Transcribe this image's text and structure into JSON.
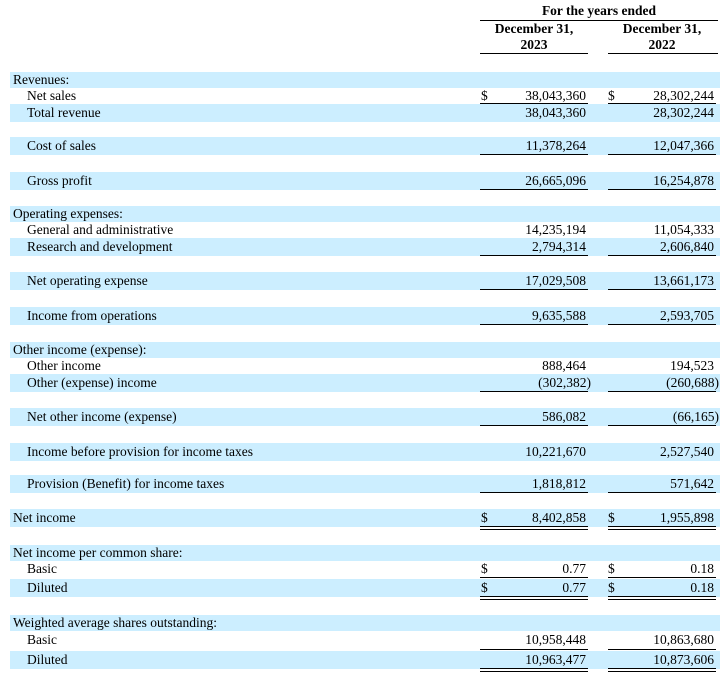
{
  "header": {
    "period": "For the years ended",
    "col1_line1": "December 31,",
    "col1_line2": "2023",
    "col2_line1": "December 31,",
    "col2_line2": "2022"
  },
  "currency_symbol": "$",
  "colors": {
    "band": "#cceeff"
  },
  "rows": {
    "revenues": {
      "label": "Revenues:"
    },
    "net_sales": {
      "label": "Net sales",
      "v2023": "38,043,360",
      "v2022": "28,302,244"
    },
    "total_revenue": {
      "label": "Total revenue",
      "v2023": "38,043,360",
      "v2022": "28,302,244"
    },
    "cost_of_sales": {
      "label": "Cost of sales",
      "v2023": "11,378,264",
      "v2022": "12,047,366"
    },
    "gross_profit": {
      "label": "Gross profit",
      "v2023": "26,665,096",
      "v2022": "16,254,878"
    },
    "operating_expenses": {
      "label": "Operating expenses:"
    },
    "general_admin": {
      "label": "General and administrative",
      "v2023": "14,235,194",
      "v2022": "11,054,333"
    },
    "research_dev": {
      "label": "Research and development",
      "v2023": "2,794,314",
      "v2022": "2,606,840"
    },
    "net_operating_expense": {
      "label": "Net operating expense",
      "v2023": "17,029,508",
      "v2022": "13,661,173"
    },
    "income_from_operations": {
      "label": "Income from operations",
      "v2023": "9,635,588",
      "v2022": "2,593,705"
    },
    "other_income_expense": {
      "label": "Other income (expense):"
    },
    "other_income": {
      "label": "Other income",
      "v2023": "888,464",
      "v2022": "194,523"
    },
    "other_expense_income": {
      "label": "Other (expense) income",
      "v2023": "(302,382)",
      "v2022": "(260,688)"
    },
    "net_other_income": {
      "label": "Net other income (expense)",
      "v2023": "586,082",
      "v2022": "(66,165)"
    },
    "income_before_tax": {
      "label": "Income before provision for income taxes",
      "v2023": "10,221,670",
      "v2022": "2,527,540"
    },
    "provision_tax": {
      "label": "Provision (Benefit) for income taxes",
      "v2023": "1,818,812",
      "v2022": "571,642"
    },
    "net_income": {
      "label": "Net income",
      "v2023": "8,402,858",
      "v2022": "1,955,898"
    },
    "eps_header": {
      "label": "Net income per common share:"
    },
    "eps_basic": {
      "label": "Basic",
      "v2023": "0.77",
      "v2022": "0.18"
    },
    "eps_diluted": {
      "label": "Diluted",
      "v2023": "0.77",
      "v2022": "0.18"
    },
    "shares_header": {
      "label": "Weighted average shares outstanding:"
    },
    "shares_basic": {
      "label": "Basic",
      "v2023": "10,958,448",
      "v2022": "10,863,680"
    },
    "shares_diluted": {
      "label": "Diluted",
      "v2023": "10,963,477",
      "v2022": "10,873,606"
    }
  }
}
